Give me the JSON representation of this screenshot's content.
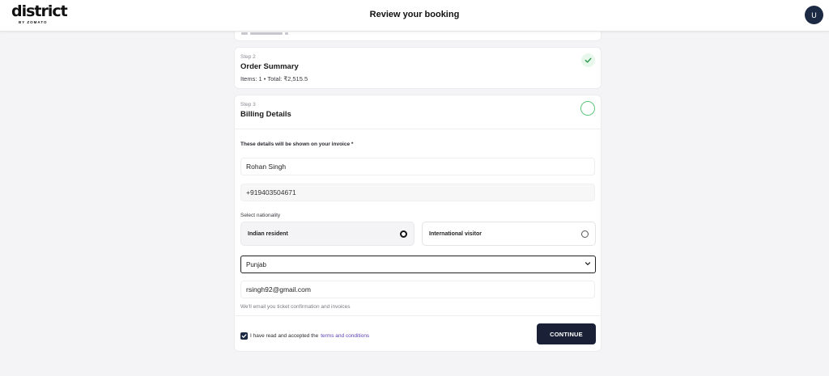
{
  "header": {
    "logo_text": "district",
    "logo_subtext": "BY ZOMATO",
    "title": "Review your booking",
    "avatar_initial": "U"
  },
  "step2": {
    "step_label": "Step 2",
    "title": "Order Summary",
    "summary": "Items: 1 • Total: ₹2,515.5",
    "status_icon": "check-icon"
  },
  "step3": {
    "step_label": "Step 3",
    "title": "Billing Details",
    "note": "These details will be shown on your invoice *",
    "name_value": "Rohan Singh",
    "phone_value": "+919403504671",
    "nationality_label": "Select nationality",
    "nationality_options": [
      {
        "label": "Indian resident",
        "selected": true
      },
      {
        "label": "International visitor",
        "selected": false
      }
    ],
    "state_value": "Punjab",
    "email_value": "rsingh92@gmail.com",
    "email_hint": "We'll email you ticket confirmation and invoices",
    "terms_prefix": "I have read and accepted the",
    "terms_link": "terms and conditions",
    "terms_checked": true,
    "continue_label": "CONTINUE"
  },
  "colors": {
    "primary": "#1a2136",
    "success": "#2e9a4f",
    "link": "#5b3fb4",
    "background": "#f4f4f6"
  }
}
